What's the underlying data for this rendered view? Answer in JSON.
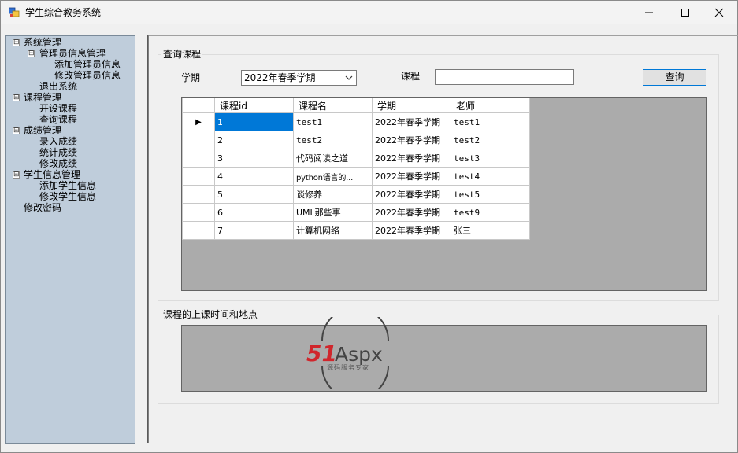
{
  "window": {
    "title": "学生综合教务系统"
  },
  "tree": {
    "items": [
      {
        "label": "系统管理",
        "level": 0,
        "expander": "⊟"
      },
      {
        "label": "管理员信息管理",
        "level": 1,
        "expander": "⊟"
      },
      {
        "label": "添加管理员信息",
        "level": 2
      },
      {
        "label": "修改管理员信息",
        "level": 2
      },
      {
        "label": "退出系统",
        "level": 1
      },
      {
        "label": "课程管理",
        "level": 0,
        "expander": "⊟"
      },
      {
        "label": "开设课程",
        "level": 1
      },
      {
        "label": "查询课程",
        "level": 1
      },
      {
        "label": "成绩管理",
        "level": 0,
        "expander": "⊟"
      },
      {
        "label": "录入成绩",
        "level": 1
      },
      {
        "label": "统计成绩",
        "level": 1
      },
      {
        "label": "修改成绩",
        "level": 1
      },
      {
        "label": "学生信息管理",
        "level": 0,
        "expander": "⊟"
      },
      {
        "label": "添加学生信息",
        "level": 1
      },
      {
        "label": "修改学生信息",
        "level": 1
      },
      {
        "label": "修改密码",
        "level": 0
      }
    ]
  },
  "query": {
    "group_title": "查询课程",
    "term_label": "学期",
    "term_value": "2022年春季学期",
    "course_label": "课程",
    "course_value": "",
    "button_label": "查询"
  },
  "grid": {
    "columns": [
      "课程id",
      "课程名",
      "学期",
      "老师"
    ],
    "rows": [
      [
        "1",
        "test1",
        "2022年春季学期",
        "test1"
      ],
      [
        "2",
        "test2",
        "2022年春季学期",
        "test2"
      ],
      [
        "3",
        "代码阅读之道",
        "2022年春季学期",
        "test3"
      ],
      [
        "4",
        "python语言的...",
        "2022年春季学期",
        "test4"
      ],
      [
        "5",
        "谈修养",
        "2022年春季学期",
        "test5"
      ],
      [
        "6",
        "UML那些事",
        "2022年春季学期",
        "test9"
      ],
      [
        "7",
        "计算机网络",
        "2022年春季学期",
        "张三"
      ]
    ],
    "current_row_marker": "▶"
  },
  "schedule": {
    "group_title": "课程的上课时间和地点"
  },
  "watermark": {
    "brand": "51Aspx",
    "brand_number": "51",
    "brand_text": "Aspx",
    "tagline": "源码服务专家"
  },
  "colors": {
    "tree_background": "#bfcddb",
    "grid_background": "#ababab",
    "selection": "#0078d7",
    "watermark_red": "#d0262c",
    "watermark_green": "#4caf50"
  }
}
